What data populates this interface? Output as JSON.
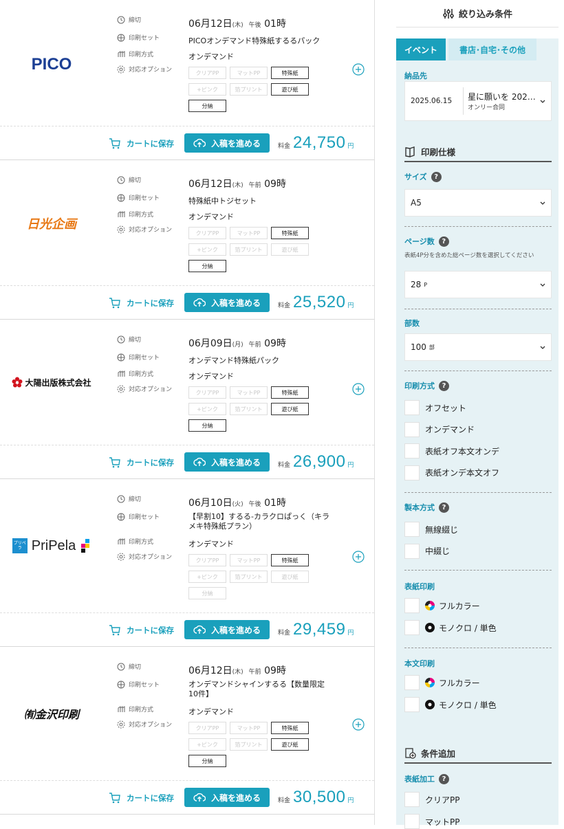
{
  "labels": {
    "deadline": "締切",
    "print_set": "印刷セット",
    "print_method": "印刷方式",
    "options": "対応オプション",
    "cart": "カートに保存",
    "upload": "入稿を進める",
    "price_label": "料金",
    "yen": "円"
  },
  "option_chips": [
    "クリアPP",
    "マットPP",
    "特殊紙",
    "+ピンク",
    "箔プリント",
    "遊び紙",
    "分納"
  ],
  "cards": [
    {
      "vendor": "PICO",
      "date": "06月12日",
      "dow": "(木)",
      "ampm": "午後",
      "time": "01時",
      "set": "PICOオンデマンド特殊紙するるパック",
      "method": "オンデマンド",
      "options_on": [
        false,
        false,
        true,
        false,
        false,
        true,
        true
      ],
      "price": "24,750"
    },
    {
      "vendor": "日光企画",
      "date": "06月12日",
      "dow": "(木)",
      "ampm": "午前",
      "time": "09時",
      "set": "特殊紙中トジセット",
      "method": "オンデマンド",
      "options_on": [
        false,
        false,
        true,
        false,
        false,
        false,
        true
      ],
      "price": "25,520"
    },
    {
      "vendor": "大陽出版株式会社",
      "date": "06月09日",
      "dow": "(月)",
      "ampm": "午前",
      "time": "09時",
      "set": "オンデマンド特殊紙パック",
      "method": "オンデマンド",
      "options_on": [
        false,
        false,
        true,
        false,
        false,
        true,
        true
      ],
      "price": "26,900"
    },
    {
      "vendor": "PriPela",
      "vendor_badge": "プリペラ",
      "date": "06月10日",
      "dow": "(火)",
      "ampm": "午後",
      "time": "01時",
      "set_line1": "【早割10】するる-カラクロぱっく（キラ",
      "set_line2": "メキ特殊紙プラン）",
      "method": "オンデマンド",
      "options_on": [
        false,
        false,
        true,
        false,
        false,
        false,
        false
      ],
      "price": "29,459"
    },
    {
      "vendor": "㈲金沢印刷",
      "date": "06月12日",
      "dow": "(木)",
      "ampm": "午前",
      "time": "09時",
      "set_line1": "オンデマンドシャインするる【数量限定",
      "set_line2": "10件】",
      "method": "オンデマンド",
      "options_on": [
        false,
        false,
        true,
        false,
        false,
        true,
        true
      ],
      "price": "30,500"
    }
  ],
  "filter": {
    "title": "絞り込み条件",
    "tab_event": "イベント",
    "tab_other": "書店･自宅･その他",
    "delivery_label": "納品先",
    "delivery_date": "2025.06.15",
    "delivery_event": "星に願いを 202…",
    "delivery_sub": "オンリー合同",
    "spec_title": "印刷仕様",
    "size_label": "サイズ",
    "size_value": "A5",
    "pages_label": "ページ数",
    "pages_note": "表紙4P分を含めた総ページ数を選択してください",
    "pages_value": "28",
    "pages_unit": "P",
    "copies_label": "部数",
    "copies_value": "100",
    "copies_unit": "部",
    "method_label": "印刷方式",
    "method_options": [
      "オフセット",
      "オンデマンド",
      "表紙オフ本文オンデ",
      "表紙オンデ本文オフ"
    ],
    "binding_label": "製本方式",
    "binding_options": [
      "無線綴じ",
      "中綴じ"
    ],
    "cover_label": "表紙印刷",
    "body_label": "本文印刷",
    "color_full": "フルカラー",
    "color_mono": "モノクロ / 単色",
    "add_title": "条件追加",
    "cover_finish_label": "表紙加工",
    "cover_finish_options": [
      "クリアPP",
      "マットPP"
    ]
  },
  "colors": {
    "accent": "#1aa0bc",
    "panel_bg": "#e6f2f5"
  }
}
